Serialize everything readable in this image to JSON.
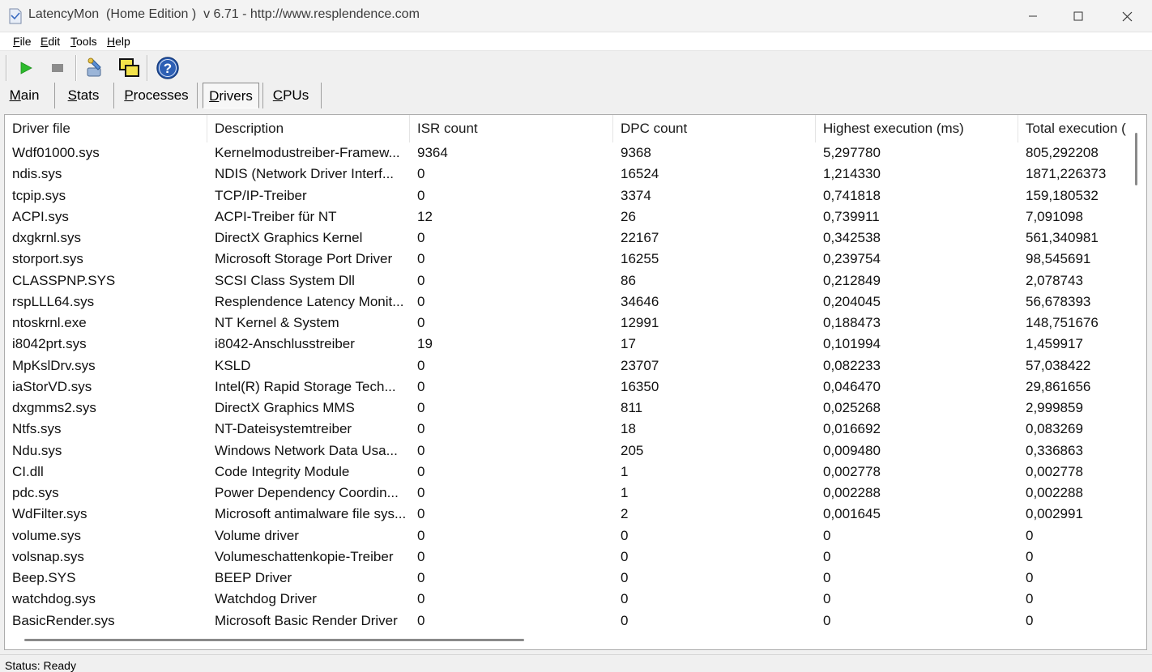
{
  "window": {
    "title": "LatencyMon  (Home Edition )  v 6.71 - http://www.resplendence.com",
    "minimize_icon": "minimize-icon",
    "maximize_icon": "maximize-icon",
    "close_icon": "close-icon"
  },
  "menu": [
    {
      "label": "File",
      "accel": "F",
      "rest": "ile"
    },
    {
      "label": "Edit",
      "accel": "E",
      "rest": "dit"
    },
    {
      "label": "Tools",
      "accel": "T",
      "rest": "ools"
    },
    {
      "label": "Help",
      "accel": "H",
      "rest": "elp"
    }
  ],
  "toolbar": {
    "start_icon": "play-icon",
    "stop_icon": "stop-icon",
    "probe_icon": "probe-tool-icon",
    "windows_icon": "windows-icon",
    "help_icon": "help-icon",
    "colors": {
      "play": "#2dbb2d",
      "stop": "#8c8c8c",
      "help": "#2d5fb4"
    }
  },
  "tabs": [
    {
      "label": "Main",
      "accel": "M",
      "rest": "ain",
      "active": false
    },
    {
      "label": "Stats",
      "accel": "S",
      "rest": "tats",
      "active": false
    },
    {
      "label": "Processes",
      "accel": "P",
      "rest": "rocesses",
      "active": false
    },
    {
      "label": "Drivers",
      "accel": "D",
      "rest": "rivers",
      "active": true
    },
    {
      "label": "CPUs",
      "accel": "C",
      "rest": "PUs",
      "active": false
    }
  ],
  "table": {
    "columns": [
      "Driver file",
      "Description",
      "ISR count",
      "DPC count",
      "Highest execution (ms)",
      "Total execution ("
    ],
    "rows": [
      [
        "Wdf01000.sys",
        "Kernelmodustreiber-Framew...",
        "9364",
        "9368",
        "5,297780",
        "805,292208"
      ],
      [
        "ndis.sys",
        "NDIS (Network Driver Interf...",
        "0",
        "16524",
        "1,214330",
        "1871,226373"
      ],
      [
        "tcpip.sys",
        "TCP/IP-Treiber",
        "0",
        "3374",
        "0,741818",
        "159,180532"
      ],
      [
        "ACPI.sys",
        "ACPI-Treiber für NT",
        "12",
        "26",
        "0,739911",
        "7,091098"
      ],
      [
        "dxgkrnl.sys",
        "DirectX Graphics Kernel",
        "0",
        "22167",
        "0,342538",
        "561,340981"
      ],
      [
        "storport.sys",
        "Microsoft Storage Port Driver",
        "0",
        "16255",
        "0,239754",
        "98,545691"
      ],
      [
        "CLASSPNP.SYS",
        "SCSI Class System Dll",
        "0",
        "86",
        "0,212849",
        "2,078743"
      ],
      [
        "rspLLL64.sys",
        "Resplendence Latency Monit...",
        "0",
        "34646",
        "0,204045",
        "56,678393"
      ],
      [
        "ntoskrnl.exe",
        "NT Kernel & System",
        "0",
        "12991",
        "0,188473",
        "148,751676"
      ],
      [
        "i8042prt.sys",
        "i8042-Anschlusstreiber",
        "19",
        "17",
        "0,101994",
        "1,459917"
      ],
      [
        "MpKslDrv.sys",
        "KSLD",
        "0",
        "23707",
        "0,082233",
        "57,038422"
      ],
      [
        "iaStorVD.sys",
        "Intel(R) Rapid Storage Tech...",
        "0",
        "16350",
        "0,046470",
        "29,861656"
      ],
      [
        "dxgmms2.sys",
        "DirectX Graphics MMS",
        "0",
        "811",
        "0,025268",
        "2,999859"
      ],
      [
        "Ntfs.sys",
        "NT-Dateisystemtreiber",
        "0",
        "18",
        "0,016692",
        "0,083269"
      ],
      [
        "Ndu.sys",
        "Windows Network Data Usa...",
        "0",
        "205",
        "0,009480",
        "0,336863"
      ],
      [
        "CI.dll",
        "Code Integrity Module",
        "0",
        "1",
        "0,002778",
        "0,002778"
      ],
      [
        "pdc.sys",
        "Power Dependency Coordin...",
        "0",
        "1",
        "0,002288",
        "0,002288"
      ],
      [
        "WdFilter.sys",
        "Microsoft antimalware file sys...",
        "0",
        "2",
        "0,001645",
        "0,002991"
      ],
      [
        "volume.sys",
        "Volume driver",
        "0",
        "0",
        "0",
        "0"
      ],
      [
        "volsnap.sys",
        "Volumeschattenkopie-Treiber",
        "0",
        "0",
        "0",
        "0"
      ],
      [
        "Beep.SYS",
        "BEEP Driver",
        "0",
        "0",
        "0",
        "0"
      ],
      [
        "watchdog.sys",
        "Watchdog Driver",
        "0",
        "0",
        "0",
        "0"
      ],
      [
        "BasicRender.sys",
        "Microsoft Basic Render Driver",
        "0",
        "0",
        "0",
        "0"
      ]
    ]
  },
  "status": {
    "text": "Status: Ready"
  }
}
